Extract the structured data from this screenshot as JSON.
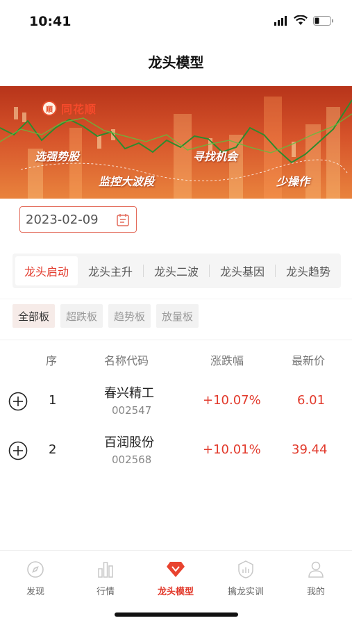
{
  "status_bar": {
    "time": "10:41"
  },
  "nav": {
    "title": "龙头模型"
  },
  "banner": {
    "logo_text": "同花顺",
    "slogans": [
      "选强势股",
      "寻找机会",
      "监控大波段",
      "少操作"
    ]
  },
  "date_picker": {
    "value": "2023-02-09"
  },
  "tabs": [
    {
      "label": "龙头启动",
      "active": true
    },
    {
      "label": "龙头主升",
      "active": false
    },
    {
      "label": "龙头二波",
      "active": false
    },
    {
      "label": "龙头基因",
      "active": false
    },
    {
      "label": "龙头趋势",
      "active": false
    }
  ],
  "filters": [
    {
      "label": "全部板",
      "active": true
    },
    {
      "label": "超跌板",
      "active": false
    },
    {
      "label": "趋势板",
      "active": false
    },
    {
      "label": "放量板",
      "active": false
    }
  ],
  "table": {
    "headers": {
      "index": "序",
      "name": "名称代码",
      "change": "涨跌幅",
      "price": "最新价"
    },
    "rows": [
      {
        "index": "1",
        "name": "春兴精工",
        "code": "002547",
        "change": "+10.07%",
        "price": "6.01"
      },
      {
        "index": "2",
        "name": "百润股份",
        "code": "002568",
        "change": "+10.01%",
        "price": "39.44"
      }
    ]
  },
  "bottom_nav": [
    {
      "label": "发现",
      "icon": "compass-icon",
      "active": false
    },
    {
      "label": "行情",
      "icon": "bar-chart-icon",
      "active": false
    },
    {
      "label": "龙头模型",
      "icon": "diamond-icon",
      "active": true
    },
    {
      "label": "擒龙实训",
      "icon": "shield-chart-icon",
      "active": false
    },
    {
      "label": "我的",
      "icon": "user-icon",
      "active": false
    }
  ],
  "colors": {
    "accent": "#e23a2c",
    "banner_top": "#b7341a",
    "banner_bottom": "#e9833d"
  }
}
